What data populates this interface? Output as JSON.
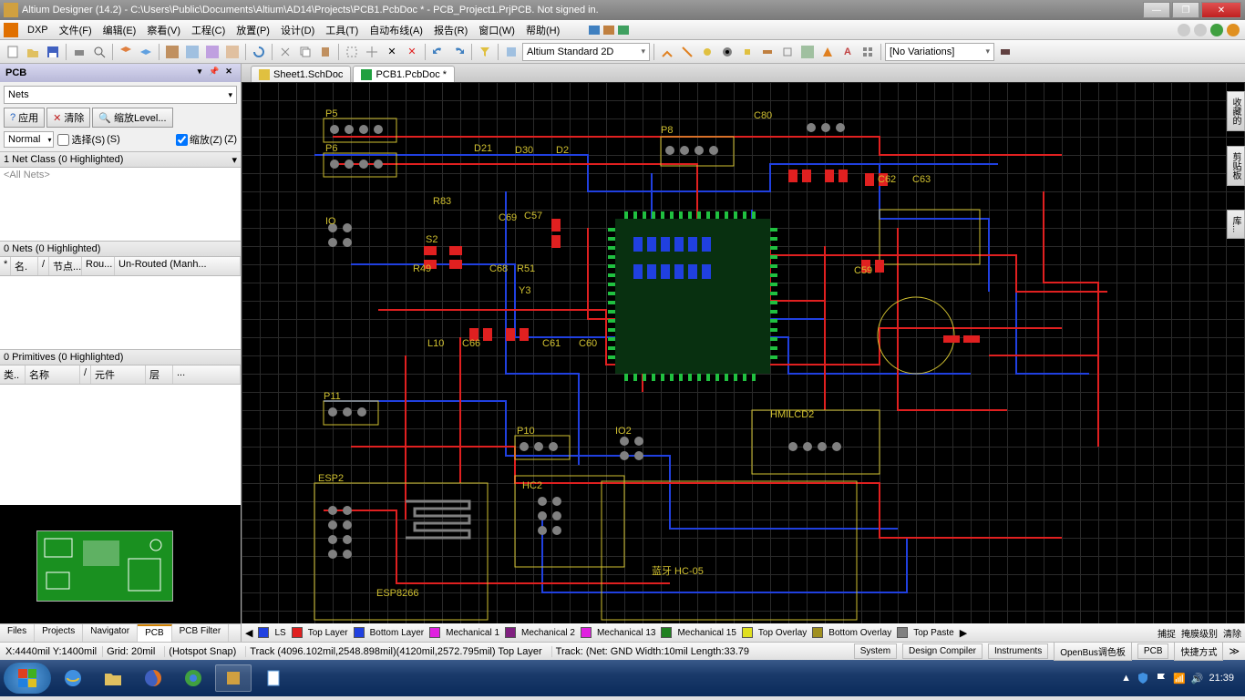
{
  "title": "Altium Designer (14.2) - C:\\Users\\Public\\Documents\\Altium\\AD14\\Projects\\PCB1.PcbDoc * - PCB_Project1.PrjPCB. Not signed in.",
  "menu": {
    "dxp": "DXP",
    "items": [
      "文件(F)",
      "编辑(E)",
      "察看(V)",
      "工程(C)",
      "放置(P)",
      "设计(D)",
      "工具(T)",
      "自动布线(A)",
      "报告(R)",
      "窗口(W)",
      "帮助(H)"
    ]
  },
  "toolbar": {
    "viewmode": "Altium Standard 2D",
    "variations": "[No Variations]"
  },
  "panel": {
    "title": "PCB",
    "dropdown": "Nets",
    "apply": "应用",
    "clear": "清除",
    "zoom": "缩放Level...",
    "normal": "Normal",
    "select": "选择(S)",
    "selkey": "(S)",
    "scale": "缩放(Z)",
    "sckey": "(Z)",
    "netclass": "1 Net Class (0 Highlighted)",
    "allnets": "<All Nets>",
    "nets0": "0 Nets (0 Highlighted)",
    "netcols": [
      "*",
      "名.",
      "/",
      "节点...",
      "Rou...",
      "Un-Routed (Manh..."
    ],
    "prim0": "0 Primitives (0 Highlighted)",
    "primcols": [
      "类..",
      "名称",
      "/",
      "元件",
      "层",
      "..."
    ]
  },
  "lefttabs": [
    "Files",
    "Projects",
    "Navigator",
    "PCB",
    "PCB Filter"
  ],
  "activetab": "PCB",
  "doctabs": [
    {
      "label": "Sheet1.SchDoc",
      "color": "#e0c040"
    },
    {
      "label": "PCB1.PcbDoc *",
      "color": "#20a040"
    }
  ],
  "sidetabs": [
    "收藏的",
    "剪贴板",
    "库..."
  ],
  "designators": [
    "P5",
    "P6",
    "P8",
    "C80",
    "IO",
    "S2",
    "R83",
    "C69",
    "C57",
    "R49",
    "C68",
    "R51",
    "Y3",
    "C59",
    "C62",
    "C63",
    "L10",
    "C66",
    "C61",
    "C60",
    "P11",
    "P10",
    "IO2",
    "HMILCD2",
    "ESP2",
    "HC2",
    "ESP8266",
    "蓝牙 HC-05",
    "D21",
    "D30",
    "D2"
  ],
  "layers": [
    {
      "label": "LS",
      "color": "#2040e0"
    },
    {
      "label": "Top Layer",
      "color": "#e02020"
    },
    {
      "label": "Bottom Layer",
      "color": "#2040e0"
    },
    {
      "label": "Mechanical 1",
      "color": "#e020e0"
    },
    {
      "label": "Mechanical 2",
      "color": "#802080"
    },
    {
      "label": "Mechanical 13",
      "color": "#e020e0"
    },
    {
      "label": "Mechanical 15",
      "color": "#208020"
    },
    {
      "label": "Top Overlay",
      "color": "#e0e020"
    },
    {
      "label": "Bottom Overlay",
      "color": "#a09020"
    },
    {
      "label": "Top Paste",
      "color": "#808080"
    }
  ],
  "layernav": {
    "capture": "捕捉",
    "mask": "掩膜级别",
    "clear": "清除"
  },
  "status": {
    "coords": "X:4440mil Y:1400mil",
    "grid": "Grid: 20mil",
    "snap": "(Hotspot Snap)",
    "track": "Track (4096.102mil,2548.898mil)(4120mil,2572.795mil)  Top Layer",
    "info": "Track: (Net: GND Width:10mil Length:33.79",
    "btns": [
      "System",
      "Design Compiler",
      "Instruments",
      "OpenBus调色板",
      "PCB",
      "快捷方式"
    ]
  },
  "clock": "21:39"
}
